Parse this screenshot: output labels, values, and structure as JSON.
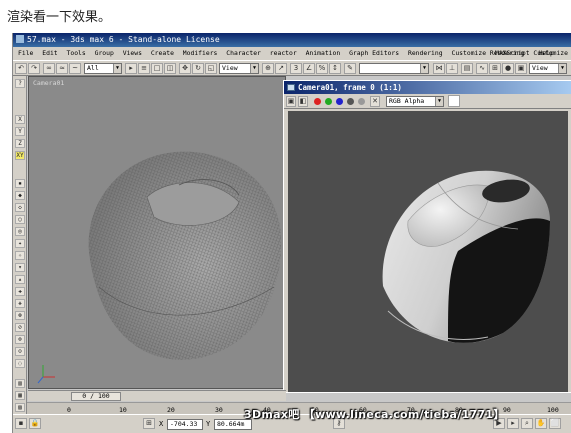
{
  "caption": "渲染看一下效果。",
  "app": {
    "title": "57.max - 3ds max 6 - Stand-alone License",
    "menu": [
      "File",
      "Edit",
      "Tools",
      "Group",
      "Views",
      "Create",
      "Modifiers",
      "Character",
      "reactor",
      "Animation",
      "Graph Editors",
      "Rendering",
      "Customize",
      "MAXScript",
      "Help"
    ],
    "menu_right": [
      "Rendering",
      "Customize"
    ],
    "toolbar": {
      "selection_filter": "All",
      "reference_coord": "View",
      "reference_coord_2": "View"
    },
    "left_tools": [
      "X",
      "Y",
      "Z",
      "XY"
    ],
    "viewport": {
      "label": "Camera01",
      "object": "mouse-wireframe"
    },
    "frame_window": {
      "title": "Camera01, frame 0 (1:1)",
      "channel": "RGB Alpha",
      "object": "mouse-render"
    },
    "timeline": {
      "slider": "0 / 100"
    },
    "ruler_ticks": [
      "0",
      "10",
      "20",
      "30",
      "40",
      "50",
      "60",
      "70",
      "80",
      "90",
      "100"
    ],
    "status": {
      "x_label": "X",
      "x_value": "-704.33",
      "y_label": "Y",
      "y_value": "80.664m"
    }
  },
  "watermark": "3Dmax吧 【www.lineca.com/tieba/1771】",
  "colors": {
    "title_bar": "#0a246a",
    "ui_gray": "#d4d0c8",
    "viewport_bg": "#8a8a8a",
    "render_bg": "#4d4d4d",
    "axis_active": "#f2e96a"
  }
}
